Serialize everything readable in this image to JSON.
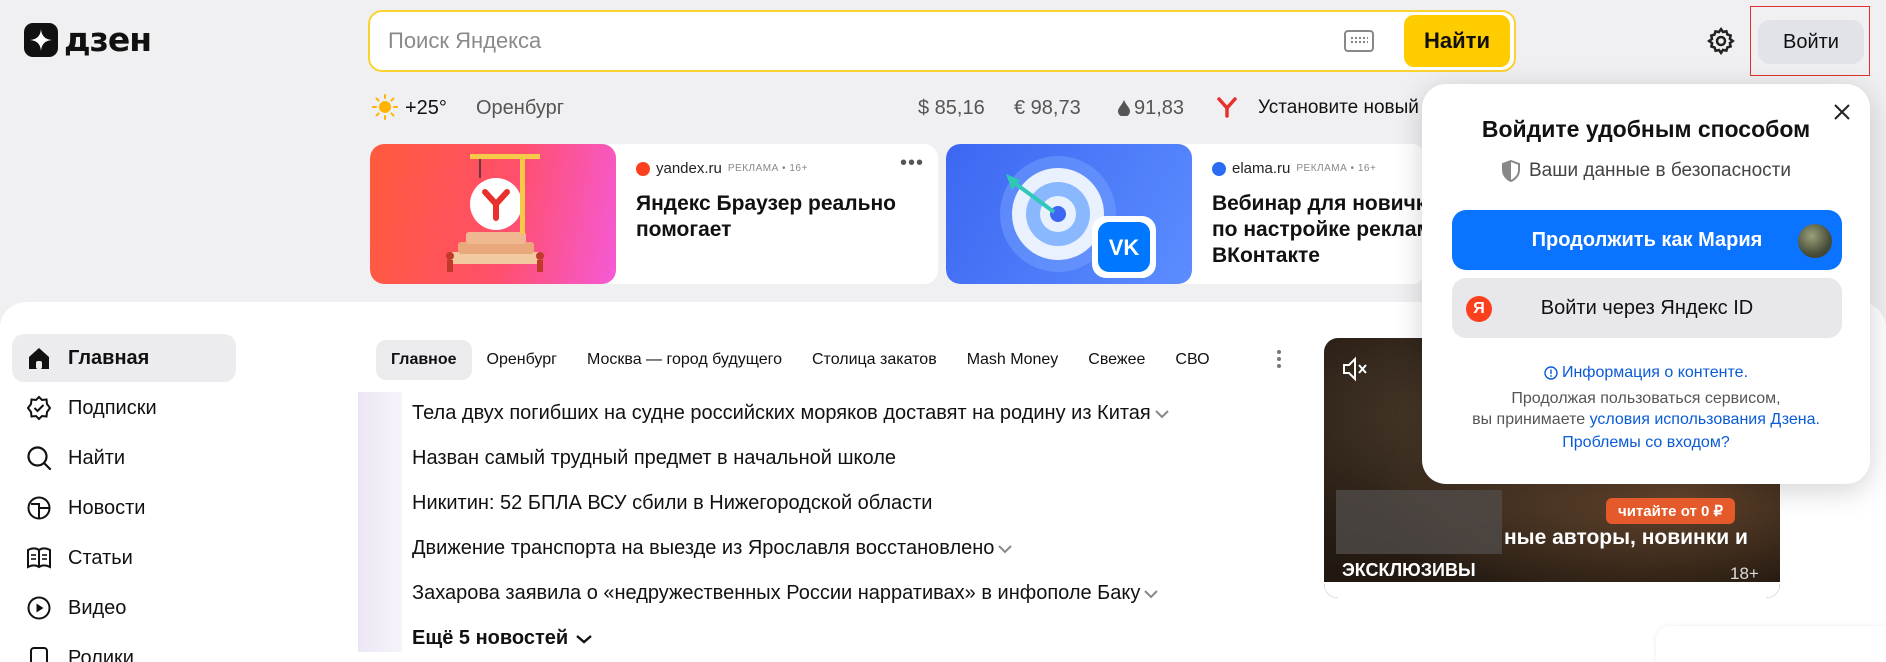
{
  "header": {
    "logo_text": "дзен",
    "search_placeholder": "Поиск Яндекса",
    "search_button": "Найти",
    "login_button": "Войти"
  },
  "infoline": {
    "temperature": "+25°",
    "city": "Оренбург",
    "usd": "$ 85,16",
    "eur": "€ 98,73",
    "oil": "91,83",
    "install_text": "Установите новый"
  },
  "ads": [
    {
      "source": "yandex.ru",
      "meta": "РЕКЛАМА • 16+",
      "title": "Яндекс Браузер реально помогает",
      "more": "•••"
    },
    {
      "source": "elama.ru",
      "meta": "РЕКЛАМА • 16+",
      "title": "Вебинар для новичк по настройке реклам ВКонтакте"
    }
  ],
  "sidebar": {
    "items": [
      {
        "label": "Главная",
        "icon": "home-icon"
      },
      {
        "label": "Подписки",
        "icon": "subscriptions-icon"
      },
      {
        "label": "Найти",
        "icon": "search-icon"
      },
      {
        "label": "Новости",
        "icon": "news-icon"
      },
      {
        "label": "Статьи",
        "icon": "articles-icon"
      },
      {
        "label": "Видео",
        "icon": "video-icon"
      },
      {
        "label": "Ролики",
        "icon": "clips-icon"
      }
    ]
  },
  "tabs": [
    "Главное",
    "Оренбург",
    "Москва — город будущего",
    "Столица закатов",
    "Mash Money",
    "Свежее",
    "СВО"
  ],
  "news": {
    "items": [
      "Тела двух погибших на судне российских моряков доставят на родину из Китая",
      "Назван самый трудный предмет в начальной школе",
      "Никитин: 52 БПЛА ВСУ сбили в Нижегородской области",
      "Движение транспорта на выезде из Ярославля восстановлено",
      "Захарова заявила о «недружественных России нарративах» в инфополе Баку"
    ],
    "more": "Ещё 5 новостей"
  },
  "video": {
    "badge": "читайте от 0 ₽",
    "title": "ные авторы, новинки и",
    "tag": "ЭКСКЛЮЗИВЫ",
    "age": "18+"
  },
  "popup": {
    "title": "Войдите удобным способом",
    "subtitle": "Ваши данные в безопасности",
    "continue_button": "Продолжить как Мария",
    "yandex_button": "Войти через Яндекс ID",
    "info_link": "Информация о контенте.",
    "terms_text": "Продолжая пользоваться сервисом,",
    "terms_text2": "вы принимаете",
    "terms_link": "условия использования Дзена.",
    "problems_link": "Проблемы со входом?"
  },
  "colors": {
    "accent": "#ffcc00",
    "primary_button": "#0a73ff",
    "yandex_red": "#fc3f1d"
  }
}
